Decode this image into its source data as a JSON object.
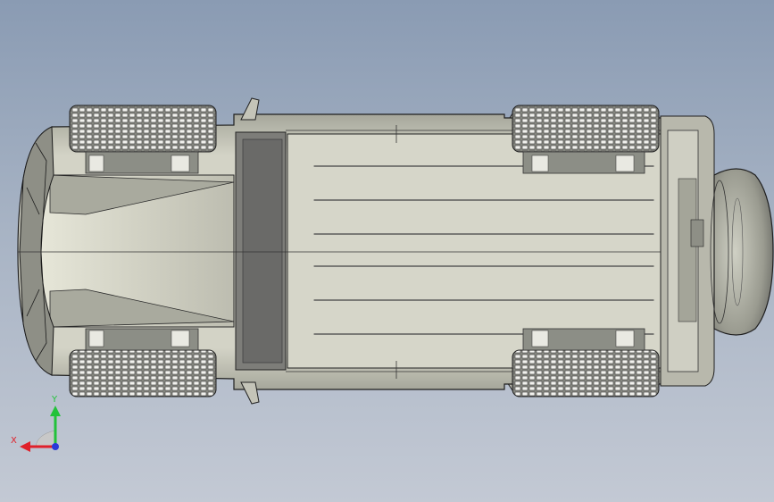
{
  "viewport": {
    "model": "vehicle-top-view",
    "colors": {
      "body": "#cfcfc2",
      "body_shadow": "#9fa094",
      "dark": "#707070",
      "tire": "#8d8f86",
      "edge": "#1f1f1f"
    }
  },
  "triad": {
    "x_label": "X",
    "y_label": "Y",
    "x_color": "#e0202a",
    "y_color": "#22c23a",
    "z_color": "#2a3ad8"
  }
}
